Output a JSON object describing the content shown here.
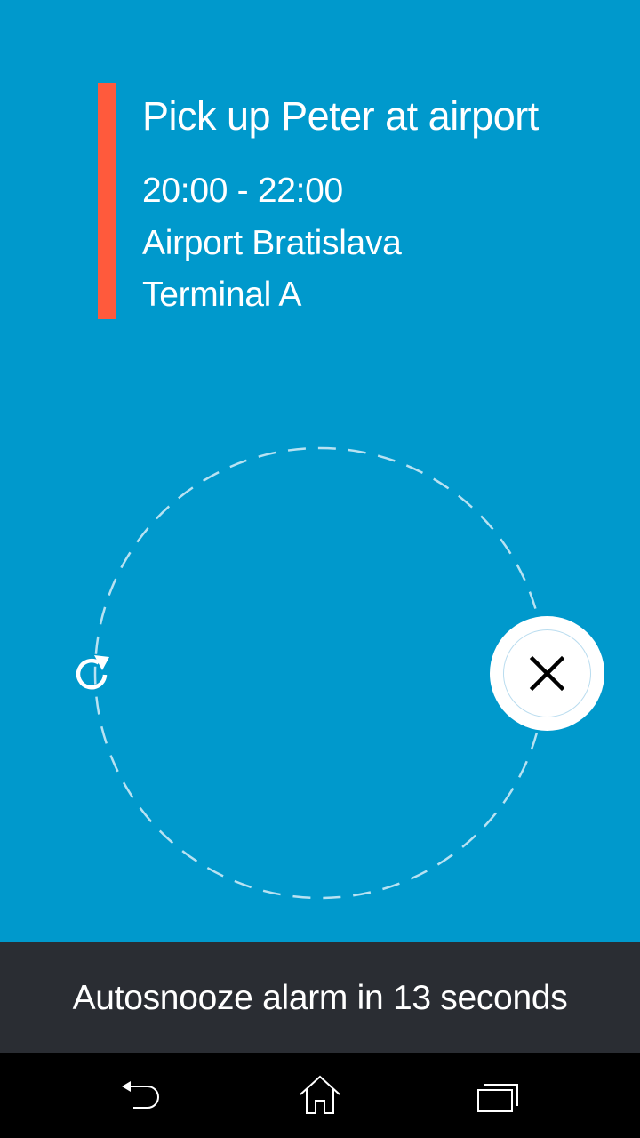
{
  "colors": {
    "background": "#0099cc",
    "accent_bar": "#ff5a3c",
    "status_bar": "#2a2d33",
    "nav_bar": "#000000",
    "dismiss_button": "#ffffff"
  },
  "event": {
    "title": "Pick up Peter at airport",
    "time": "20:00 - 22:00",
    "location": "Airport Bratislava",
    "detail": "Terminal A"
  },
  "controls": {
    "snooze_icon": "snooze-refresh-icon",
    "dismiss_icon": "close-icon"
  },
  "status": {
    "text": "Autosnooze alarm in 13 seconds"
  },
  "nav": {
    "back_icon": "back-icon",
    "home_icon": "home-icon",
    "recents_icon": "recents-icon"
  }
}
